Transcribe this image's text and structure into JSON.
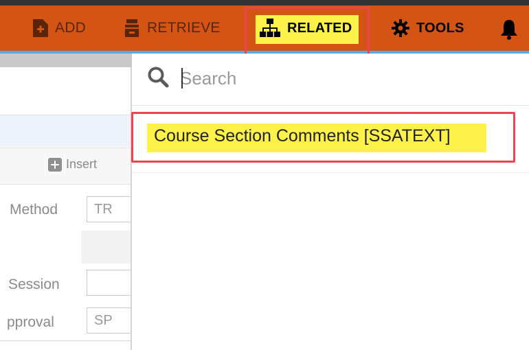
{
  "toolbar": {
    "add_label": "ADD",
    "retrieve_label": "RETRIEVE",
    "related_label": "RELATED",
    "tools_label": "TOOLS",
    "icons": [
      "add-page-icon",
      "retrieve-icon",
      "sitemap-icon",
      "gear-icon",
      "bell-icon"
    ]
  },
  "left_panel": {
    "insert_label": "Insert",
    "fields": [
      {
        "label": "Method",
        "value": "TR"
      },
      {
        "label": "Session",
        "value": ""
      },
      {
        "label": "pproval",
        "value": "SP"
      }
    ]
  },
  "related_menu": {
    "search_placeholder": "Search",
    "results": [
      "Course Section Comments [SSATEXT]"
    ]
  },
  "colors": {
    "toolbar_bg": "#d45513",
    "highlight": "#fdf24a",
    "callout_border": "#e8474d",
    "accent_line": "#5ba8e6"
  }
}
